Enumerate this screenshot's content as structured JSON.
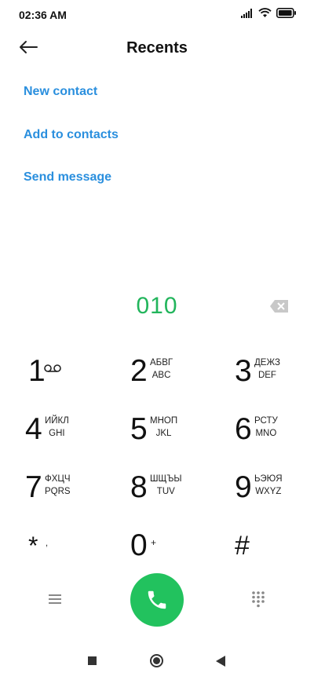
{
  "status": {
    "time": "02:36 AM",
    "icons": [
      "signal-icon",
      "wifi-icon",
      "battery-icon"
    ]
  },
  "header": {
    "title": "Recents",
    "back_icon": "back-arrow-icon"
  },
  "actions": [
    "New contact",
    "Add to contacts",
    "Send message"
  ],
  "dialed_number": "010",
  "keys": [
    {
      "digit": "1",
      "sub1": "",
      "sub2": "",
      "icon": "voicemail-icon"
    },
    {
      "digit": "2",
      "sub1": "АБВГ",
      "sub2": "ABC"
    },
    {
      "digit": "3",
      "sub1": "ДЕЖЗ",
      "sub2": "DEF"
    },
    {
      "digit": "4",
      "sub1": "ИЙКЛ",
      "sub2": "GHI"
    },
    {
      "digit": "5",
      "sub1": "МНОП",
      "sub2": "JKL"
    },
    {
      "digit": "6",
      "sub1": "РСТУ",
      "sub2": "MNO"
    },
    {
      "digit": "7",
      "sub1": "ФХЦЧ",
      "sub2": "PQRS"
    },
    {
      "digit": "8",
      "sub1": "ШЩЪЫ",
      "sub2": "TUV"
    },
    {
      "digit": "9",
      "sub1": "ЬЭЮЯ",
      "sub2": "WXYZ"
    },
    {
      "digit": "*",
      "sub1": "",
      "sub2": ",",
      "secondary": ","
    },
    {
      "digit": "0",
      "sub1": "",
      "sub2": "+",
      "secondary": "+"
    },
    {
      "digit": "#",
      "sub1": "",
      "sub2": ""
    }
  ],
  "colors": {
    "accent_blue": "#2a8fde",
    "number_green": "#22b55c",
    "call_green": "#22c25e"
  },
  "bottom": {
    "menu_icon": "menu-icon",
    "call_icon": "phone-icon",
    "dialpad_icon": "dialpad-icon"
  },
  "nav": {
    "icons": [
      "recents-square-icon",
      "home-circle-icon",
      "back-triangle-icon"
    ]
  }
}
